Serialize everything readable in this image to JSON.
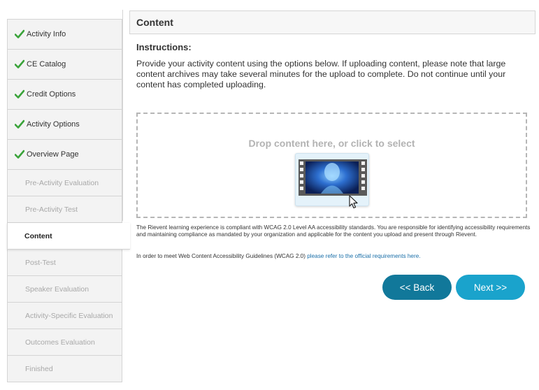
{
  "sidebar": {
    "items": [
      {
        "label": "Activity Info",
        "completed": true
      },
      {
        "label": "CE Catalog",
        "completed": true
      },
      {
        "label": "Credit Options",
        "completed": true
      },
      {
        "label": "Activity Options",
        "completed": true
      },
      {
        "label": "Overview Page",
        "completed": true
      },
      {
        "label": "Pre-Activity Evaluation",
        "completed": false
      },
      {
        "label": "Pre-Activity Test",
        "completed": false
      },
      {
        "label": "Content",
        "active": true
      },
      {
        "label": "Post-Test",
        "completed": false
      },
      {
        "label": "Speaker Evaluation",
        "completed": false
      },
      {
        "label": "Activity-Specific Evaluation",
        "completed": false
      },
      {
        "label": "Outcomes Evaluation",
        "completed": false
      },
      {
        "label": "Finished",
        "completed": false
      }
    ]
  },
  "main": {
    "title": "Content",
    "instructions_title": "Instructions:",
    "instructions_text": "Provide your activity content using the options below. If uploading content, please note that large content archives may take several minutes for the upload to complete. Do not continue until your content has completed uploading.",
    "dropzone_label": "Drop content here, or click to select",
    "compliance_text": "The Rievent learning experience is compliant with WCAG 2.0 Level AA accessibility standards. You are responsible for identifying accessibility requirements and maintaining compliance as mandated by your organization and applicable for the content you upload and present through Rievent.",
    "wcag_prefix": "In order to meet Web Content Accessibility Guidelines (WCAG 2.0) ",
    "wcag_link": "please refer to the official requirements here.",
    "back_label": "<< Back",
    "next_label": "Next >>"
  },
  "colors": {
    "check_green": "#3aa33a",
    "back_button": "#11789a",
    "next_button": "#1aa3cc",
    "link": "#1a6fa8"
  },
  "icons": {
    "completed": "check-icon",
    "upload": "video-film-icon",
    "pointer": "mouse-pointer-icon"
  }
}
